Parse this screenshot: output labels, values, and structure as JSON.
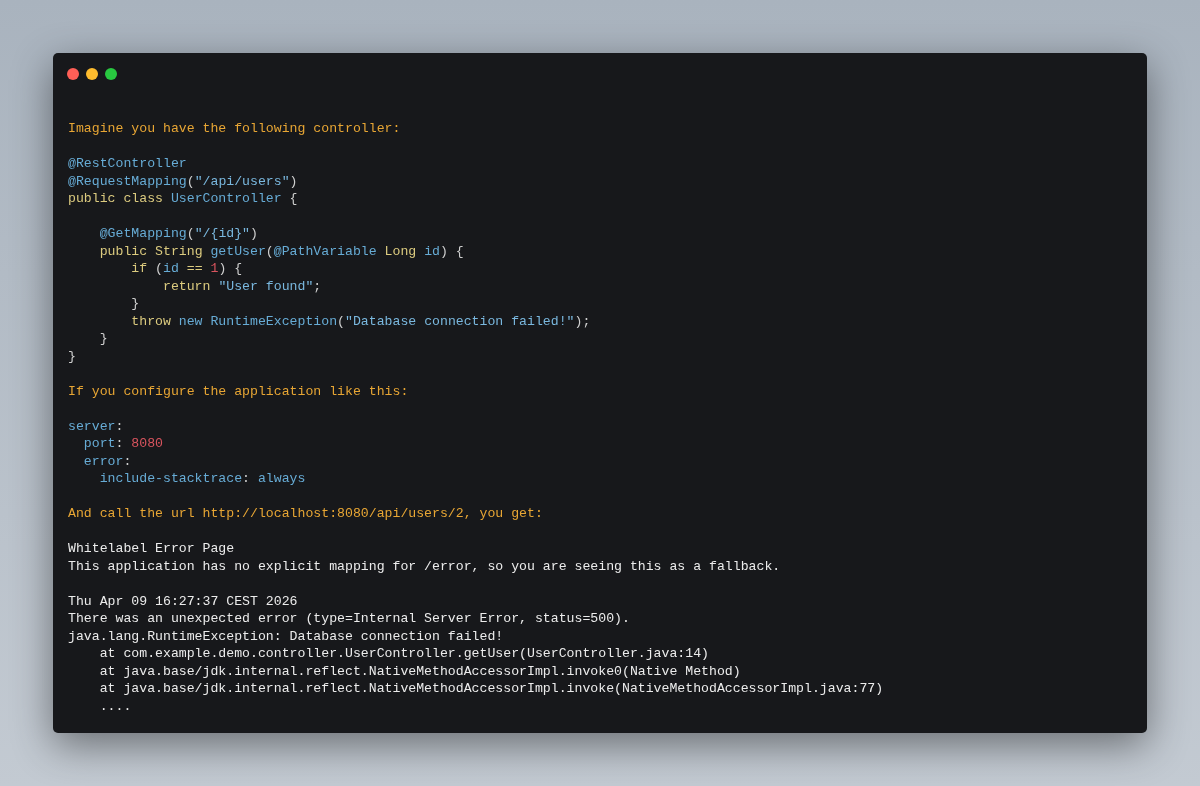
{
  "window": {
    "controls": [
      {
        "kind": "close"
      },
      {
        "kind": "minimize"
      },
      {
        "kind": "maximize"
      }
    ]
  },
  "blocks": [
    [
      [
        {
          "text": "Imagine you have the following controller:",
          "kind": "prose"
        }
      ]
    ],
    [
      [
        {
          "text": "@RestController",
          "kind": "type"
        }
      ],
      [
        {
          "text": "@RequestMapping",
          "kind": "type"
        },
        {
          "text": "(",
          "kind": "punct"
        },
        {
          "text": "\"/api/users\"",
          "kind": "string"
        },
        {
          "text": ")",
          "kind": "punct"
        }
      ],
      [
        {
          "text": "public class ",
          "kind": "keyword"
        },
        {
          "text": "UserController",
          "kind": "type"
        },
        {
          "text": " {",
          "kind": "punct"
        }
      ]
    ],
    [
      [
        {
          "text": "    @GetMapping",
          "kind": "type"
        },
        {
          "text": "(",
          "kind": "punct"
        },
        {
          "text": "\"/{id}\"",
          "kind": "string"
        },
        {
          "text": ")",
          "kind": "punct"
        }
      ],
      [
        {
          "text": "    public ",
          "kind": "keyword"
        },
        {
          "text": "String",
          "kind": "keyword"
        },
        {
          "text": " getUser",
          "kind": "type"
        },
        {
          "text": "(",
          "kind": "punct"
        },
        {
          "text": "@PathVariable",
          "kind": "type"
        },
        {
          "text": " Long",
          "kind": "keyword"
        },
        {
          "text": " id",
          "kind": "type"
        },
        {
          "text": ") {",
          "kind": "punct"
        }
      ],
      [
        {
          "text": "        if ",
          "kind": "keyword"
        },
        {
          "text": "(",
          "kind": "punct"
        },
        {
          "text": "id ",
          "kind": "type"
        },
        {
          "text": "== ",
          "kind": "keyword"
        },
        {
          "text": "1",
          "kind": "number"
        },
        {
          "text": ") {",
          "kind": "punct"
        }
      ],
      [
        {
          "text": "            return ",
          "kind": "keyword"
        },
        {
          "text": "\"User found\"",
          "kind": "string"
        },
        {
          "text": ";",
          "kind": "punct"
        }
      ],
      [
        {
          "text": "        }",
          "kind": "punct"
        }
      ],
      [
        {
          "text": "        throw ",
          "kind": "keyword"
        },
        {
          "text": "new ",
          "kind": "type"
        },
        {
          "text": "RuntimeException",
          "kind": "type"
        },
        {
          "text": "(",
          "kind": "punct"
        },
        {
          "text": "\"Database connection failed!\"",
          "kind": "string"
        },
        {
          "text": ");",
          "kind": "punct"
        }
      ],
      [
        {
          "text": "    }",
          "kind": "punct"
        }
      ],
      [
        {
          "text": "}",
          "kind": "punct"
        }
      ]
    ],
    [
      [
        {
          "text": "If you configure the application like this:",
          "kind": "prose"
        }
      ]
    ],
    [
      [
        {
          "text": "server",
          "kind": "type"
        },
        {
          "text": ":",
          "kind": "punct"
        }
      ],
      [
        {
          "text": "  port",
          "kind": "type"
        },
        {
          "text": ": ",
          "kind": "punct"
        },
        {
          "text": "8080",
          "kind": "number"
        }
      ],
      [
        {
          "text": "  error",
          "kind": "type"
        },
        {
          "text": ":",
          "kind": "punct"
        }
      ],
      [
        {
          "text": "    include-stacktrace",
          "kind": "type"
        },
        {
          "text": ": ",
          "kind": "punct"
        },
        {
          "text": "always",
          "kind": "type"
        }
      ]
    ],
    [
      [
        {
          "text": "And call the url http://localhost:8080/api/users/2, you get:",
          "kind": "prose"
        }
      ]
    ],
    [
      [
        {
          "text": "Whitelabel Error Page",
          "kind": "plain"
        }
      ],
      [
        {
          "text": "This application has no explicit mapping for /error, so you are seeing this as a fallback.",
          "kind": "plain"
        }
      ]
    ],
    [
      [
        {
          "text": "Thu Apr 09 16:27:37 CEST 2026",
          "kind": "plain"
        }
      ],
      [
        {
          "text": "There was an unexpected error (type=Internal Server Error, status=500).",
          "kind": "plain"
        }
      ],
      [
        {
          "text": "java.lang.RuntimeException: Database connection failed!",
          "kind": "plain"
        }
      ],
      [
        {
          "text": "    at com.example.demo.controller.UserController.getUser(UserController.java:14)",
          "kind": "plain"
        }
      ],
      [
        {
          "text": "    at java.base/jdk.internal.reflect.NativeMethodAccessorImpl.invoke0(Native Method)",
          "kind": "plain"
        }
      ],
      [
        {
          "text": "    at java.base/jdk.internal.reflect.NativeMethodAccessorImpl.invoke(NativeMethodAccessorImpl.java:77)",
          "kind": "plain"
        }
      ],
      [
        {
          "text": "    ....",
          "kind": "plain"
        }
      ]
    ]
  ]
}
